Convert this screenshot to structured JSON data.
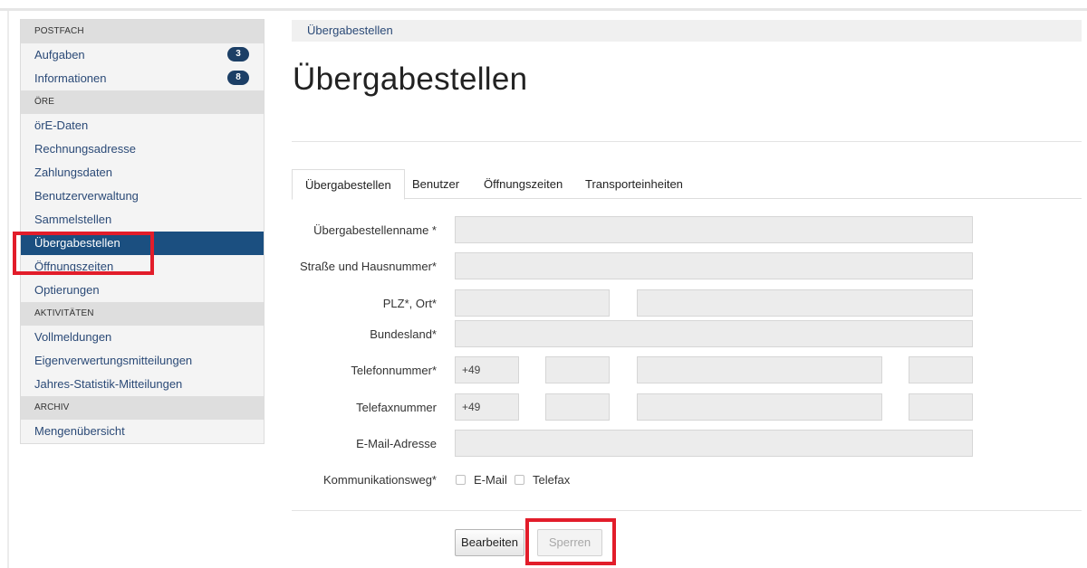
{
  "sidebar": {
    "sections": [
      {
        "heading": "POSTFACH",
        "items": [
          {
            "label": "Aufgaben",
            "badge": "3"
          },
          {
            "label": "Informationen",
            "badge": "8"
          }
        ]
      },
      {
        "heading": "ÖRE",
        "items": [
          {
            "label": "örE-Daten"
          },
          {
            "label": "Rechnungsadresse"
          },
          {
            "label": "Zahlungsdaten"
          },
          {
            "label": "Benutzerverwaltung"
          },
          {
            "label": "Sammelstellen"
          },
          {
            "label": "Übergabestellen",
            "active": true
          },
          {
            "label": "Öffnungszeiten"
          },
          {
            "label": "Optierungen"
          }
        ]
      },
      {
        "heading": "AKTIVITÄTEN",
        "items": [
          {
            "label": "Vollmeldungen"
          },
          {
            "label": "Eigenverwertungsmitteilungen"
          },
          {
            "label": "Jahres-Statistik-Mitteilungen"
          }
        ]
      },
      {
        "heading": "ARCHIV",
        "items": [
          {
            "label": "Mengenübersicht"
          }
        ]
      }
    ]
  },
  "breadcrumb": "Übergabestellen",
  "page_title": "Übergabestellen",
  "tabs": [
    "Übergabestellen",
    "Benutzer",
    "Öffnungszeiten",
    "Transporteinheiten"
  ],
  "form": {
    "name_label": "Übergabestellenname *",
    "street_label": "Straße und Hausnummer*",
    "plz_label": "PLZ*, Ort*",
    "state_label": "Bundesland*",
    "phone_label": "Telefonnummer*",
    "phone_prefix": "+49",
    "fax_label": "Telefaxnummer",
    "fax_prefix": "+49",
    "email_label": "E-Mail-Adresse",
    "channel_label": "Kommunikationsweg*",
    "channel_options": [
      "E-Mail",
      "Telefax"
    ]
  },
  "buttons": {
    "edit": "Bearbeiten",
    "lock": "Sperren"
  },
  "colors": {
    "active_nav": "#1b4f80",
    "badge": "#1c3f66",
    "highlight": "#e21d2a"
  }
}
